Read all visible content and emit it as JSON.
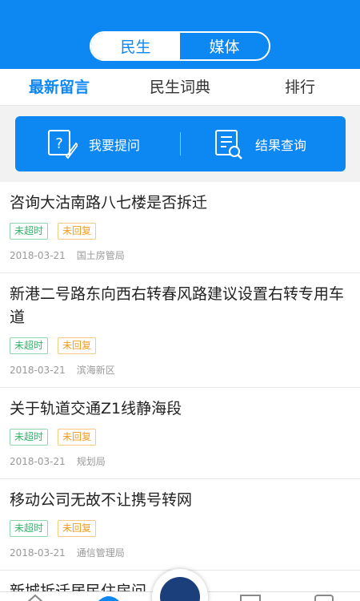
{
  "header": {
    "segments": [
      {
        "label": "民生",
        "active": true
      },
      {
        "label": "媒体",
        "active": false
      }
    ]
  },
  "tabs": [
    {
      "label": "最新留言",
      "active": true
    },
    {
      "label": "民生词典",
      "active": false
    },
    {
      "label": "排行",
      "active": false
    }
  ],
  "actions": {
    "ask": {
      "label": "我要提问",
      "icon": "question-pen-icon"
    },
    "query": {
      "label": "结果查询",
      "icon": "document-search-icon"
    }
  },
  "messages": [
    {
      "title": "咨询大沽南路八七楼是否拆迁",
      "tags": [
        "未超时",
        "未回复"
      ],
      "date": "2018-03-21",
      "department": "国土房管局"
    },
    {
      "title": "新港二号路东向西右转春风路建议设置右转专用车道",
      "tags": [
        "未超时",
        "未回复"
      ],
      "date": "2018-03-21",
      "department": "滨海新区"
    },
    {
      "title": "关于轨道交通Z1线静海段",
      "tags": [
        "未超时",
        "未回复"
      ],
      "date": "2018-03-21",
      "department": "规划局"
    },
    {
      "title": "移动公司无故不让携号转网",
      "tags": [
        "未超时",
        "未回复"
      ],
      "date": "2018-03-21",
      "department": "通信管理局"
    },
    {
      "title": "新城拆迁居民住房问...移动",
      "tags": [],
      "date": "",
      "department": ""
    }
  ],
  "colors": {
    "primary": "#0d87f2",
    "tag_green": "#2db56a",
    "tag_orange": "#f29b1d"
  }
}
